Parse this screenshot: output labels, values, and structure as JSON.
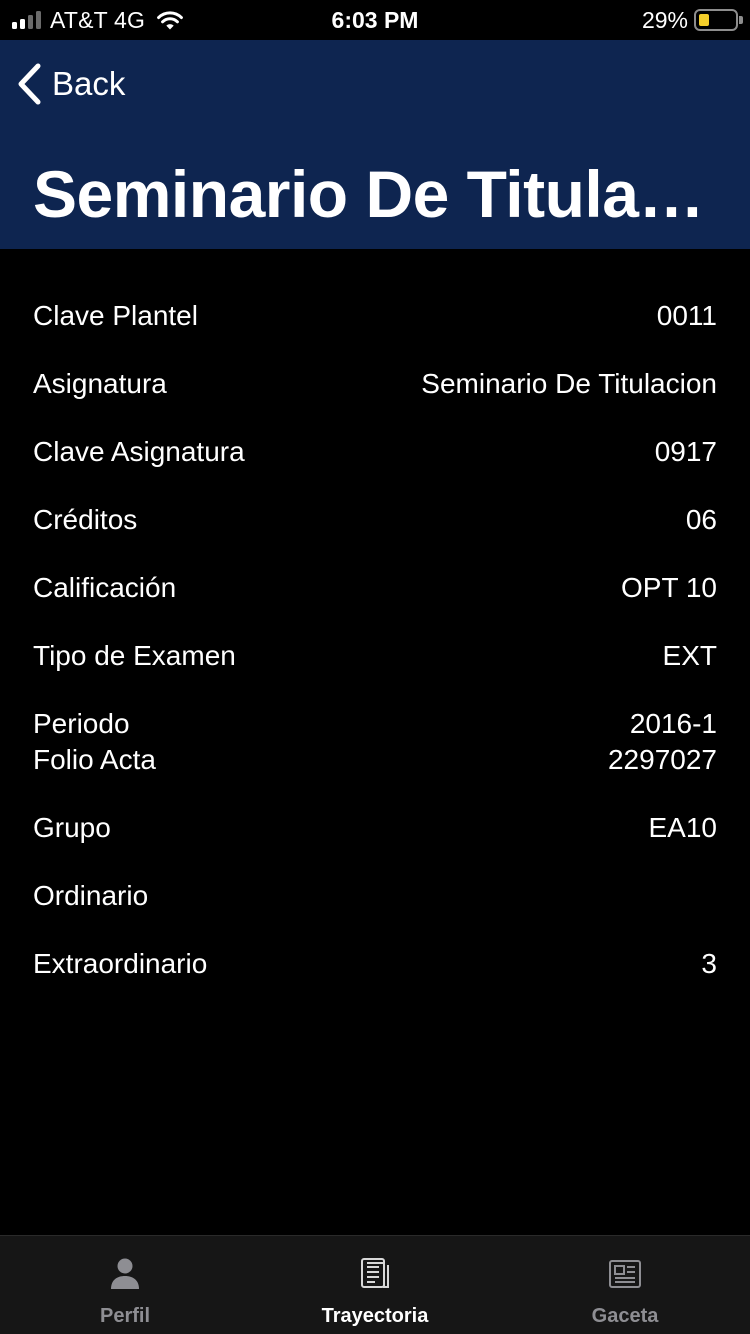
{
  "status_bar": {
    "carrier": "AT&T 4G",
    "time": "6:03 PM",
    "battery_percent": "29%",
    "battery_level": 0.29,
    "battery_color": "#f5cf2a",
    "icons": [
      "signal-icon",
      "wifi-icon",
      "battery-icon"
    ]
  },
  "header": {
    "back_label": "Back",
    "title": "Seminario De Titulacion",
    "background_color": "#0e2550"
  },
  "details": {
    "rows": [
      {
        "label": "Clave Plantel",
        "value": "0011"
      },
      {
        "label": "Asignatura",
        "value": "Seminario De Titulacion"
      },
      {
        "label": "Clave Asignatura",
        "value": "0917"
      },
      {
        "label": "Créditos",
        "value": "06"
      },
      {
        "label": "Calificación",
        "value": "OPT 10"
      },
      {
        "label": "Tipo de Examen",
        "value": "EXT"
      },
      {
        "label": "Periodo",
        "value": "2016-1"
      },
      {
        "label": "Folio Acta",
        "value": "2297027"
      },
      {
        "label": "Grupo",
        "value": "EA10"
      },
      {
        "label": "Ordinario",
        "value": ""
      },
      {
        "label": "Extraordinario",
        "value": "3"
      }
    ]
  },
  "tab_bar": {
    "tabs": [
      {
        "label": "Perfil",
        "icon": "person-icon",
        "active": false
      },
      {
        "label": "Trayectoria",
        "icon": "document-icon",
        "active": true
      },
      {
        "label": "Gaceta",
        "icon": "newspaper-icon",
        "active": false
      }
    ]
  }
}
